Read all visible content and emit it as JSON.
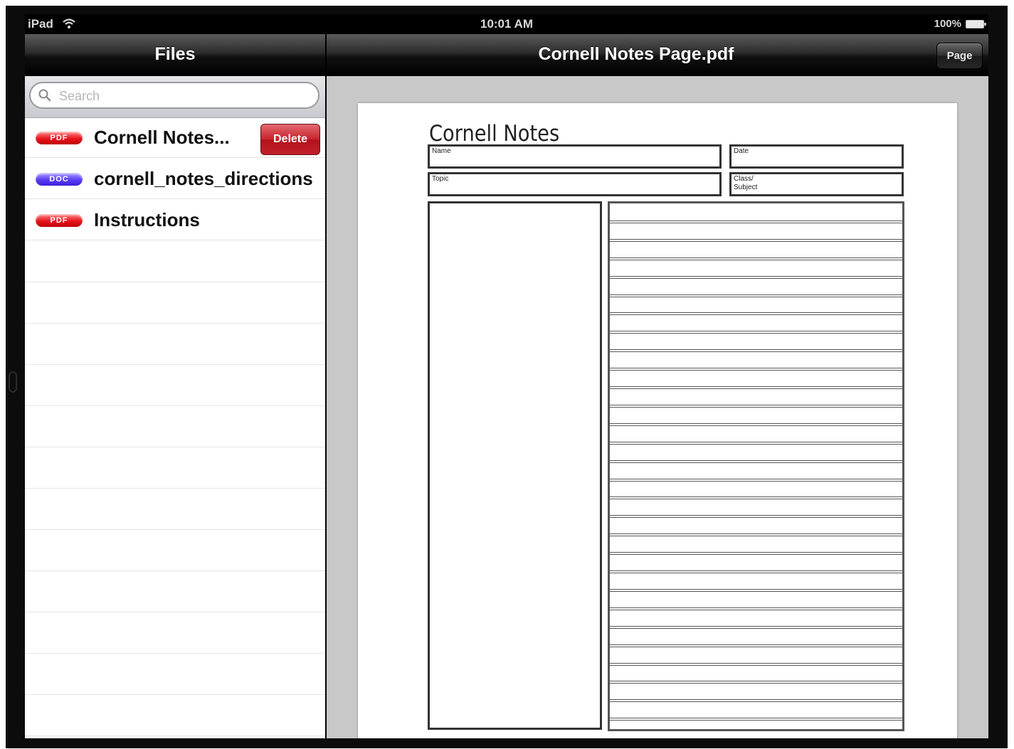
{
  "status_bar": {
    "carrier": "iPad",
    "time": "10:01 AM",
    "battery": "100%"
  },
  "files_panel": {
    "title": "Files",
    "search_placeholder": "Search",
    "files": [
      {
        "name": "Cornell Notes...",
        "type": "PDF",
        "badge_color": "#e8131b",
        "delete_label": "Delete"
      },
      {
        "name": "cornell_notes_directions",
        "type": "DOC",
        "badge_color": "#5a3cf5"
      },
      {
        "name": "Instructions",
        "type": "PDF",
        "badge_color": "#e8131b"
      }
    ]
  },
  "document": {
    "title": "Cornell Notes Page.pdf",
    "page_button_label": "Page",
    "sheet": {
      "heading": "Cornell Notes",
      "name_label": "Name",
      "date_label": "Date",
      "topic_label": "Topic",
      "class_label": "Class/ Subject"
    }
  },
  "colors": {
    "delete_button": "#c8222b",
    "viewer_background": "#c8c8c8"
  }
}
